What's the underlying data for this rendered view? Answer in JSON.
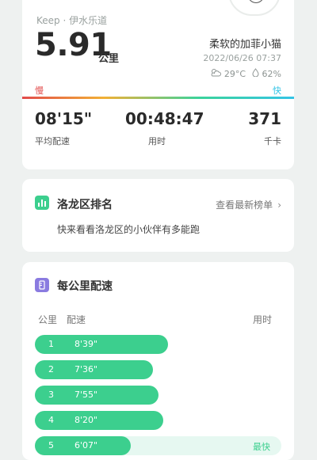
{
  "summary": {
    "source": "Keep · 伊水乐道",
    "distance": "5.91",
    "distance_unit": "公里",
    "nickname": "柔软的加菲小猫",
    "datetime": "2022/06/26 07:37",
    "weather_icon": "partly-cloudy-icon",
    "temperature": "29°C",
    "humidity_icon": "droplet-icon",
    "humidity": "62%",
    "speed_slow_label": "慢",
    "speed_fast_label": "快",
    "stats": [
      {
        "value": "08'15\"",
        "label": "平均配速"
      },
      {
        "value": "00:48:47",
        "label": "用时"
      },
      {
        "value": "371",
        "label": "千卡"
      }
    ]
  },
  "ranking": {
    "icon": "bar-chart-icon",
    "title": "洛龙区排名",
    "link": "查看最新榜单",
    "description": "快来看看洛龙区的小伙伴有多能跑"
  },
  "pace": {
    "icon": "ruler-icon",
    "title": "每公里配速",
    "col_km": "公里",
    "col_pace": "配速",
    "col_time": "用时",
    "fastest_label": "最快",
    "rows": [
      {
        "km": "1",
        "pace": "8'39\"",
        "fraction": 0.54
      },
      {
        "km": "2",
        "pace": "7'36\"",
        "fraction": 0.48
      },
      {
        "km": "3",
        "pace": "7'55\"",
        "fraction": 0.5
      },
      {
        "km": "4",
        "pace": "8'20\"",
        "fraction": 0.52
      },
      {
        "km": "5",
        "pace": "6'07\"",
        "fraction": 0.39,
        "fastest": true
      }
    ]
  },
  "colors": {
    "accent": "#3ccf8e",
    "accent_light": "#e6f8f1",
    "slow": "#e24b4b",
    "fast": "#34c4e6",
    "rank_icon_bg": "#3ccf8e",
    "pace_icon_bg": "#8a7be0"
  }
}
